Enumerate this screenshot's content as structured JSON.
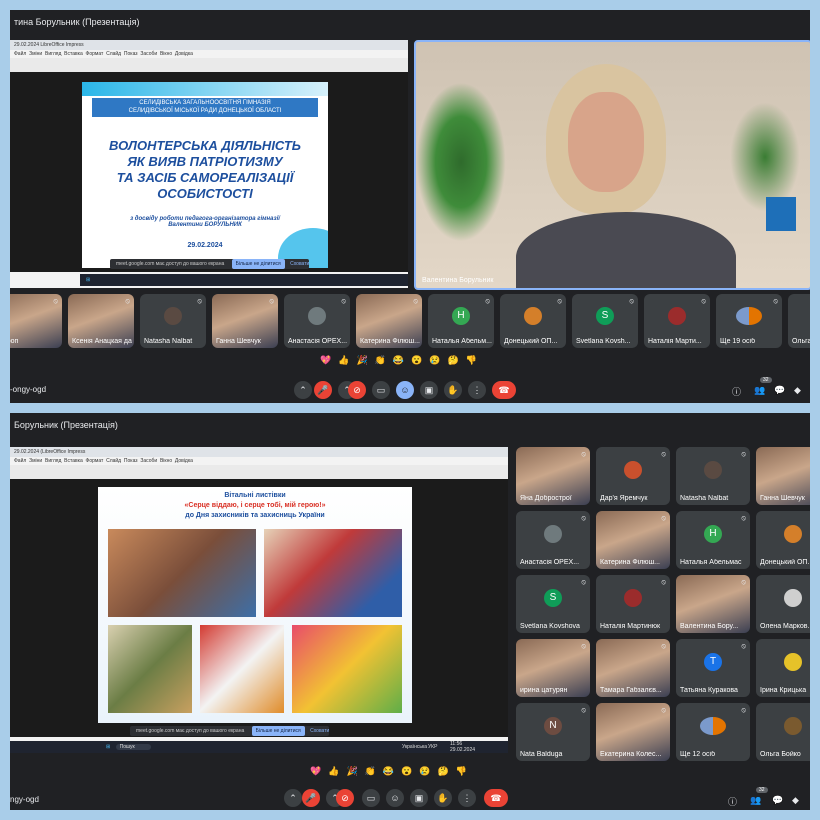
{
  "shot1": {
    "window_title": "тина Борульник (Презентація)",
    "libreoffice": {
      "title": "29.02.2024 LibreOffice Impress",
      "menu": [
        "Файл",
        "Зміни",
        "Вигляд",
        "Вставка",
        "Формат",
        "Слайд",
        "Показ",
        "Засоби",
        "Вікно",
        "Довідка"
      ]
    },
    "slide": {
      "school_line1": "СЕЛИДІВСЬКА ЗАГАЛЬНООСВІТНЯ ГІМНАЗІЯ",
      "school_line2": "СЕЛИДІВСЬКОЇ МІСЬКОЇ РАДИ ДОНЕЦЬКОЇ ОБЛАСТІ",
      "title_line1": "ВОЛОНТЕРСЬКА ДІЯЛЬНІСТЬ",
      "title_line2": "ЯК ВИЯВ ПАТРІОТИЗМУ",
      "title_line3": "ТА ЗАСІБ САМОРЕАЛІЗАЦІЇ",
      "title_line4": "ОСОБИСТОСТІ",
      "subtitle_line1": "з досвіду роботи педагога-організатора гімназії",
      "subtitle_line2": "Валентини БОРУЛЬНИК",
      "date": "29.02.2024"
    },
    "notice": {
      "text": "meet.google.com має доступ до вашого екрана",
      "button": "Більше не ділитися",
      "hide": "Сховати"
    },
    "speaker_name": "Валентина Борульник",
    "participants": [
      {
        "name": "строп",
        "type": "photo"
      },
      {
        "name": "Ксенія Анацкая дар'я яремчук",
        "type": "photo"
      },
      {
        "name": "Natasha Nalbat",
        "type": "avatar",
        "letter": "",
        "color": "#5a4a42"
      },
      {
        "name": "Ганна Шевчук",
        "type": "photo"
      },
      {
        "name": "Анастасія ОРЕХ...",
        "type": "avatar",
        "letter": "",
        "color": "#6f7a7d"
      },
      {
        "name": "Катерина Філюш...",
        "type": "photo"
      },
      {
        "name": "Наталья Абельм...",
        "type": "avatar",
        "letter": "Н",
        "color": "#34a853"
      },
      {
        "name": "Донецький ОП...",
        "type": "avatar",
        "letter": "",
        "color": "#d47f2a"
      },
      {
        "name": "Svetlana Kovsh...",
        "type": "avatar",
        "letter": "S",
        "color": "#0f9d58"
      },
      {
        "name": "Наталія Марти...",
        "type": "avatar",
        "letter": "",
        "color": "#9b2c2c"
      },
      {
        "name": "Ще 19 осіб",
        "type": "more"
      },
      {
        "name": "Ольга Бойко",
        "type": "avatar",
        "letter": "",
        "color": "#7a5a2f"
      }
    ],
    "reactions": [
      "💖",
      "👍",
      "🎉",
      "👏",
      "😂",
      "😮",
      "😢",
      "🤔",
      "👎"
    ],
    "meeting_code": "-ongy-ogd",
    "people_count": "32"
  },
  "shot2": {
    "window_title": "Борульник (Презентація)",
    "libreoffice": {
      "title": "29.02.2024 (LibreOffice Impress",
      "menu": [
        "Файл",
        "Зміни",
        "Вигляд",
        "Вставка",
        "Формат",
        "Слайд",
        "Показ",
        "Засоби",
        "Вікно",
        "Довідка"
      ]
    },
    "slide": {
      "line1": "Вітальні листівки",
      "line2": "«Серце віддаю, і серце тобі, мій герою!»",
      "line3": "до Дня захисників та захисниць України"
    },
    "notice": {
      "text": "meet.google.com має доступ до вашого екрана",
      "button": "Більше не ділитися",
      "hide": "Сховати"
    },
    "taskbar": {
      "search": "Пошук",
      "lang": "УКР",
      "time": "11:56",
      "date": "29.02.2024",
      "layout": "Українська"
    },
    "participants": [
      {
        "name": "Яна Добрострої",
        "type": "photo"
      },
      {
        "name": "Дар'я Яремчук",
        "type": "avatar",
        "letter": "",
        "color": "#c9502d"
      },
      {
        "name": "Natasha Nalbat",
        "type": "avatar",
        "letter": "",
        "color": "#5a4a42"
      },
      {
        "name": "Ганна Шевчук",
        "type": "photo"
      },
      {
        "name": "Анастасія ОРЕХ...",
        "type": "avatar",
        "letter": "",
        "color": "#6f7a7d"
      },
      {
        "name": "Катерина Філюш...",
        "type": "photo"
      },
      {
        "name": "Наталья Абельмас",
        "type": "avatar",
        "letter": "Н",
        "color": "#34a853"
      },
      {
        "name": "Донецький ОП...",
        "type": "avatar",
        "letter": "",
        "color": "#d47f2a"
      },
      {
        "name": "Svetlana Kovshova",
        "type": "avatar",
        "letter": "S",
        "color": "#0f9d58"
      },
      {
        "name": "Наталія Мартинюк",
        "type": "avatar",
        "letter": "",
        "color": "#9b2c2c"
      },
      {
        "name": "Валентина Бору...",
        "type": "photo"
      },
      {
        "name": "Олена Марков...",
        "type": "avatar",
        "letter": "",
        "color": "#cfcfcf"
      },
      {
        "name": "ирина цатурян",
        "type": "photo"
      },
      {
        "name": "Тамара Габзалєв...",
        "type": "photo"
      },
      {
        "name": "Татьяна Куракова",
        "type": "avatar",
        "letter": "Т",
        "color": "#1a73e8"
      },
      {
        "name": "Ірина Крицька",
        "type": "avatar",
        "letter": "",
        "color": "#e6c229"
      },
      {
        "name": "Nata Balduga",
        "type": "avatar",
        "letter": "N",
        "color": "#6d4c41"
      },
      {
        "name": "Екатерина Колес...",
        "type": "photo"
      },
      {
        "name": "Ще 12 осіб",
        "type": "more"
      },
      {
        "name": "Ольга Бойко",
        "type": "avatar",
        "letter": "",
        "color": "#7a5a2f"
      }
    ],
    "reactions": [
      "💖",
      "👍",
      "🎉",
      "👏",
      "😂",
      "😮",
      "😢",
      "🤔",
      "👎"
    ],
    "meeting_code": "ngy-ogd",
    "people_count": "32"
  }
}
